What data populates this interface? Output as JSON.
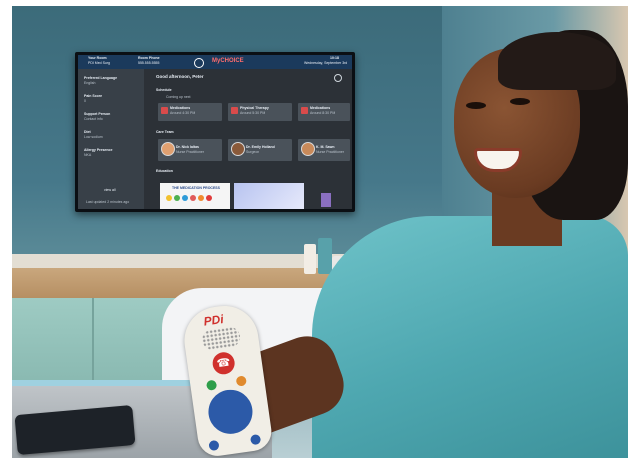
{
  "tv": {
    "header": {
      "left_title": "Your Room",
      "left_sub": "PDI Med Surg",
      "phone_title": "Room Phone",
      "phone_sub": "555.555.5555",
      "brand": "MyCHOICE",
      "time": "10:18",
      "date": "Wednesday, September 3rd"
    },
    "sidebar": {
      "items": [
        {
          "label": "Preferred Language",
          "value": "English"
        },
        {
          "label": "Pain Score",
          "value": "0"
        },
        {
          "label": "Support Person",
          "value": "Contact info"
        },
        {
          "label": "Diet",
          "value": "Low sodium"
        },
        {
          "label": "Allergy Presence",
          "value": "NKA"
        }
      ],
      "footer_label": "view all",
      "footer_note": "Last updated 2 minutes ago"
    },
    "greeting": "Good afternoon, Peter",
    "schedule": {
      "title": "Schedule",
      "filter": "Coming up next",
      "items": [
        {
          "label": "Medications",
          "time": "Around 4:30 PM"
        },
        {
          "label": "Physical Therapy",
          "time": "Around 5:30 PM"
        },
        {
          "label": "Medications",
          "time": "Around 8:30 PM"
        }
      ]
    },
    "care_team": {
      "title": "Care Team",
      "members": [
        {
          "name": "Dr. Nick Ialtas",
          "role": "Nurse Practitioner"
        },
        {
          "name": "Dr. Emily Holland",
          "role": "Surgeon"
        },
        {
          "name": "K. M. Sawn",
          "role": "Nurse Practitioner"
        }
      ]
    },
    "education": {
      "title": "Education",
      "card1_title": "THE MEDICATION PROCESS"
    }
  },
  "remote": {
    "brand": "PDi",
    "call_symbol": "☎"
  },
  "colors": {
    "tv_header": "#1b3a5c",
    "scrub_teal": "#4ea7b0",
    "remote_red": "#d0312d",
    "remote_blue": "#2c5aa8"
  }
}
